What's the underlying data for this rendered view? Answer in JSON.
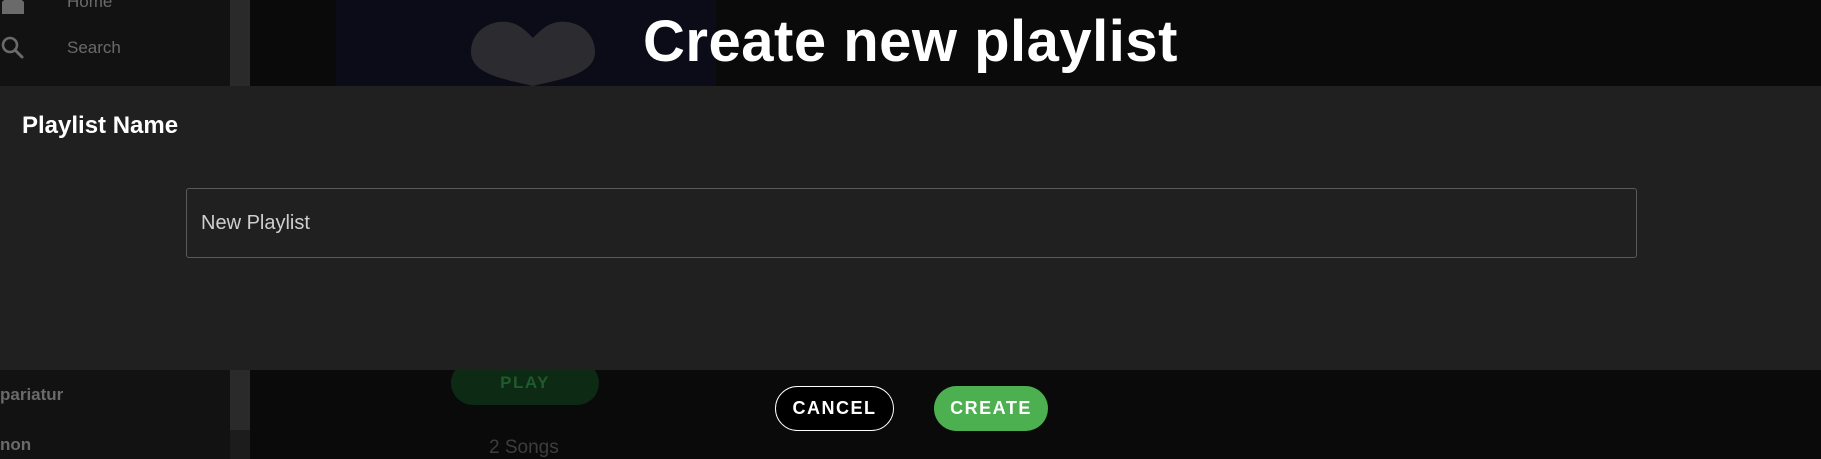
{
  "colors": {
    "background": "#000000",
    "panel": "#202020",
    "accent": "#4caf50",
    "text": "#ffffff"
  },
  "sidebar": {
    "nav": [
      {
        "label": "Home",
        "icon": "home-icon"
      },
      {
        "label": "Search",
        "icon": "search-icon"
      }
    ],
    "playlists": [
      "pariatur",
      "non"
    ]
  },
  "background": {
    "play_label": "PLAY",
    "song_count": "2 Songs"
  },
  "modal": {
    "title": "Create new playlist",
    "field_label": "Playlist Name",
    "input_value": "New Playlist",
    "cancel_label": "CANCEL",
    "create_label": "CREATE"
  }
}
